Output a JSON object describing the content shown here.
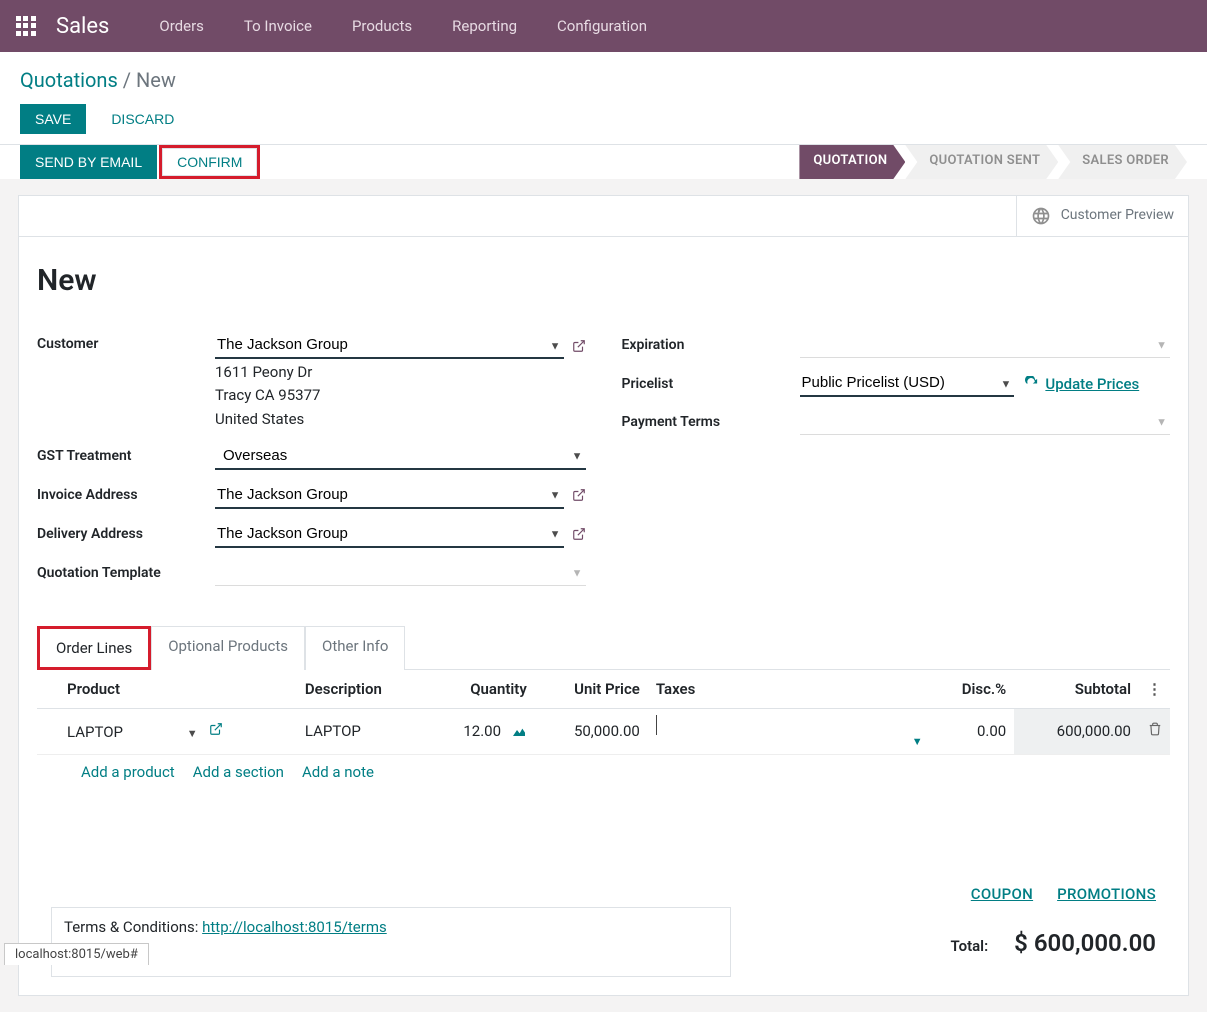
{
  "topbar": {
    "app_name": "Sales",
    "menu": [
      "Orders",
      "To Invoice",
      "Products",
      "Reporting",
      "Configuration"
    ]
  },
  "breadcrumb": {
    "root": "Quotations",
    "sep": "/",
    "current": "New"
  },
  "controls": {
    "save": "SAVE",
    "discard": "DISCARD"
  },
  "actions": {
    "send": "SEND BY EMAIL",
    "confirm": "CONFIRM"
  },
  "status": [
    "QUOTATION",
    "QUOTATION SENT",
    "SALES ORDER"
  ],
  "preview": "Customer Preview",
  "title": "New",
  "left": {
    "customer_label": "Customer",
    "customer_value": "The Jackson Group",
    "address_line1": "1611 Peony Dr",
    "address_line2": "Tracy CA 95377",
    "address_line3": "United States",
    "gst_label": "GST Treatment",
    "gst_value": "Overseas",
    "invoice_addr_label": "Invoice Address",
    "invoice_addr_value": "The Jackson Group",
    "delivery_addr_label": "Delivery Address",
    "delivery_addr_value": "The Jackson Group",
    "quote_tpl_label": "Quotation Template",
    "quote_tpl_value": ""
  },
  "right": {
    "expiration_label": "Expiration",
    "expiration_value": "",
    "pricelist_label": "Pricelist",
    "pricelist_value": "Public Pricelist (USD)",
    "update_prices": "Update Prices",
    "payment_terms_label": "Payment Terms",
    "payment_terms_value": ""
  },
  "tabs": {
    "t1": "Order Lines",
    "t2": "Optional Products",
    "t3": "Other Info"
  },
  "table": {
    "headers": {
      "product": "Product",
      "description": "Description",
      "quantity": "Quantity",
      "unit_price": "Unit Price",
      "taxes": "Taxes",
      "disc": "Disc.%",
      "subtotal": "Subtotal"
    },
    "row": {
      "product": "LAPTOP",
      "description": "LAPTOP",
      "quantity": "12.00",
      "unit_price": "50,000.00",
      "taxes": "",
      "disc": "0.00",
      "subtotal": "600,000.00"
    }
  },
  "addlinks": {
    "product": "Add a product",
    "section": "Add a section",
    "note": "Add a note"
  },
  "coupons": {
    "coupon": "COUPON",
    "promotions": "PROMOTIONS"
  },
  "totals": {
    "label": "Total:",
    "value": "$ 600,000.00"
  },
  "terms": {
    "prefix": "Terms & Conditions: ",
    "link": "http://localhost:8015/terms"
  },
  "footer": "localhost:8015/web#"
}
